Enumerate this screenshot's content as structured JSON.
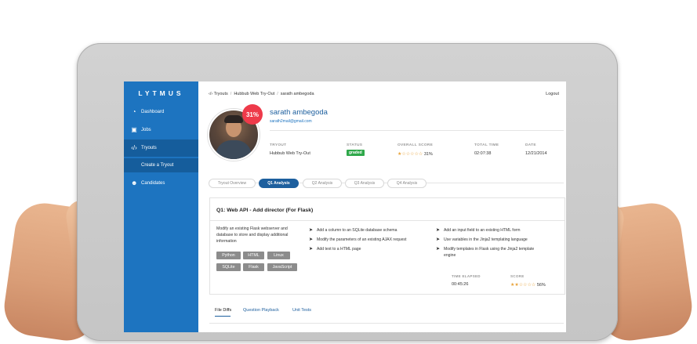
{
  "brand": "LYTMUS",
  "sidebar": {
    "items": [
      {
        "label": "Dashboard",
        "icon": "dashboard-icon"
      },
      {
        "label": "Jobs",
        "icon": "briefcase-icon"
      },
      {
        "label": "Tryouts",
        "icon": "code-icon"
      },
      {
        "label": "Create a Tryout",
        "icon": ""
      },
      {
        "label": "Candidates",
        "icon": "users-icon"
      }
    ]
  },
  "breadcrumb": {
    "root": "Tryouts",
    "tryout": "Hubbub Web Try-Out",
    "candidate": "sarath ambegoda"
  },
  "logout": "Logout",
  "profile": {
    "score_badge": "31%",
    "name": "sarath ambegoda",
    "email": "sarath2mail@gmail.com"
  },
  "summary": {
    "tryout_label": "TRYOUT",
    "tryout_value": "Hubbub Web Try-Out",
    "status_label": "STATUS",
    "status_value": "graded",
    "score_label": "OVERALL SCORE",
    "score_stars": "★☆☆☆☆☆",
    "score_value": "31%",
    "time_label": "TOTAL TIME",
    "time_value": "02:07:38",
    "date_label": "DATE",
    "date_value": "12/21/2014"
  },
  "tabs": [
    "Tryout Overview",
    "Q1 Analysis",
    "Q2 Analysis",
    "Q3 Analysis",
    "Q4 Analysis"
  ],
  "question": {
    "title": "Q1: Web API - Add director (For Flask)",
    "description": "Modify an existing Flask webserver and database to store and display additional information",
    "tags": [
      "Python",
      "HTML",
      "Linux",
      "SQLite",
      "Flask",
      "JavaScript"
    ],
    "tasks_left": [
      "Add a column to an SQLite database schema",
      "Modify the parameters of an existing AJAX request",
      "Add text to a HTML page"
    ],
    "tasks_right": [
      "Add an input field to an existing HTML form",
      "Use variables in the Jinja2 templating language",
      "Modify templates in Flask using the Jinja2 template engine"
    ],
    "time_label": "TIME ELAPSED",
    "time_value": "00:45:26",
    "score_label": "SCORE",
    "score_stars": "★★☆☆☆☆",
    "score_value": "56%"
  },
  "bottom_tabs": [
    "File Diffs",
    "Question Playback",
    "Unit Tests"
  ],
  "colors": {
    "sidebar": "#1d74c0",
    "accent": "#1d5f9e",
    "badge_red": "#ee3a4a",
    "status_green": "#2fa84a",
    "star": "#e8a33a"
  }
}
